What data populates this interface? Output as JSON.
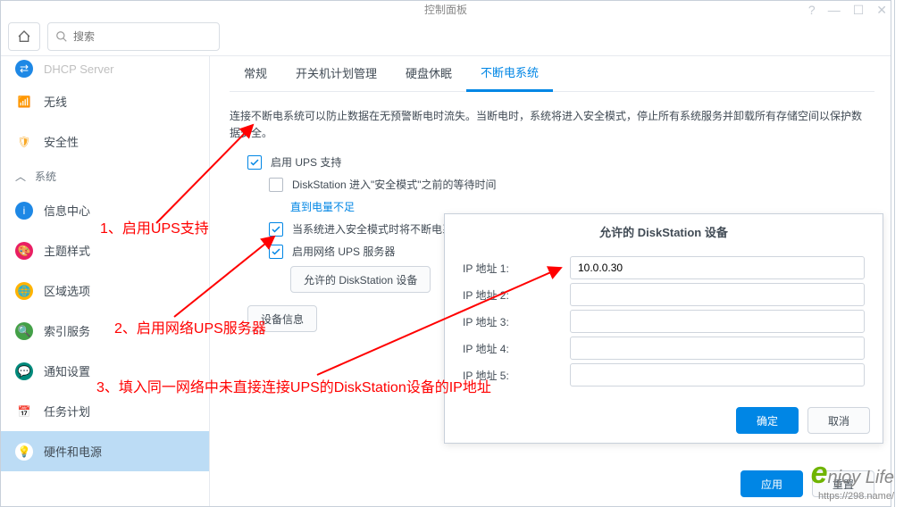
{
  "window": {
    "title": "控制面板"
  },
  "search": {
    "placeholder": "搜索"
  },
  "sidebar": {
    "top_item": "DHCP Server",
    "items": [
      {
        "label": "无线",
        "icon_bg": "#1e88e5",
        "glyph": "≈"
      },
      {
        "label": "安全性",
        "icon_bg": "#f9a825",
        "glyph": "🛡"
      }
    ],
    "section": "系统",
    "sys_items": [
      {
        "label": "信息中心",
        "icon_bg": "#1e88e5",
        "glyph": "i"
      },
      {
        "label": "主题样式",
        "icon_bg": "#e91e63",
        "glyph": "🎨"
      },
      {
        "label": "区域选项",
        "icon_bg": "#ffb300",
        "glyph": "🌐"
      },
      {
        "label": "索引服务",
        "icon_bg": "#43a047",
        "glyph": "🔍"
      },
      {
        "label": "通知设置",
        "icon_bg": "#00897b",
        "glyph": "💬"
      },
      {
        "label": "任务计划",
        "icon_bg": "#e53935",
        "glyph": "📅"
      },
      {
        "label": "硬件和电源",
        "icon_bg": "#fdd835",
        "glyph": "💡"
      }
    ]
  },
  "tabs": [
    "常规",
    "开关机计划管理",
    "硬盘休眠",
    "不断电系统"
  ],
  "desc": "连接不断电系统可以防止数据在无预警断电时流失。当断电时，系统将进入安全模式，停止所有系统服务并卸载所有存储空间以保护数据安全。",
  "chk1": "启用 UPS 支持",
  "chk2": "DiskStation 进入\"安全模式\"之前的等待时间",
  "link1": "直到电量不足",
  "chk3": "当系统进入安全模式时将不断电系统关机",
  "chk4": "启用网络 UPS 服务器",
  "btn_allow": "允许的 DiskStation 设备",
  "btn_devinfo": "设备信息",
  "modal": {
    "title": "允许的 DiskStation 设备",
    "fields": [
      "IP 地址 1:",
      "IP 地址 2:",
      "IP 地址 3:",
      "IP 地址 4:",
      "IP 地址 5:"
    ],
    "value1": "10.0.0.30",
    "ok": "确定",
    "cancel": "取消"
  },
  "footer": {
    "apply": "应用",
    "reset": "重置"
  },
  "anno": {
    "a1": "1、启用UPS支持",
    "a2": "2、启用网络UPS服务器",
    "a3": "3、填入同一网络中未直接连接UPS的DiskStation设备的IP地址"
  },
  "watermark": {
    "brand_e": "e",
    "brand_txt": "njoy Life",
    "url": "https://298.name/"
  }
}
